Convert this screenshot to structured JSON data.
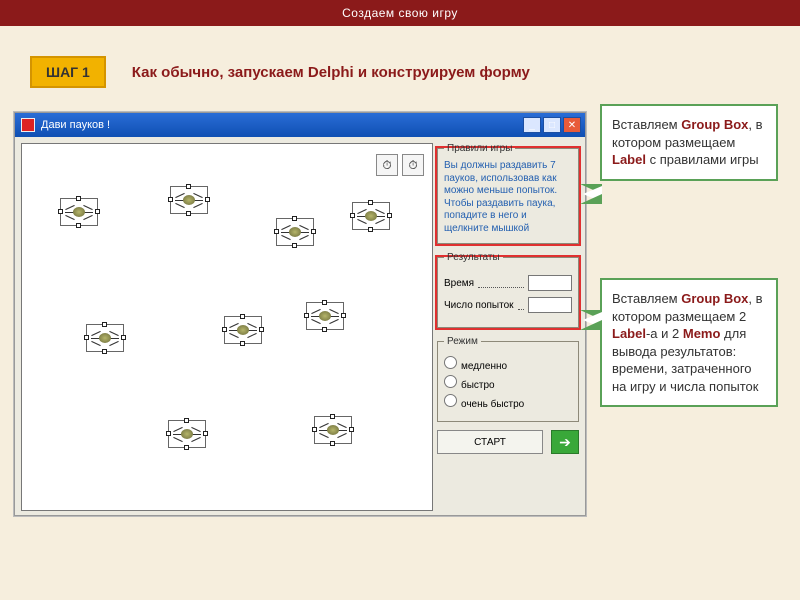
{
  "header": "Создаем свою игру",
  "step": {
    "badge": "ШАГ 1",
    "title": "Как обычно, запускаем Delphi и конструируем форму"
  },
  "window": {
    "title": "Дави пауков !",
    "rules": {
      "legend": "Правили игры",
      "text": "Вы должны раздавить 7 пауков, использовав как можно меньше попыток. Чтобы раздавить паука, попадите в него и щелкните мышкой"
    },
    "results": {
      "legend": "Результаты",
      "time_label": "Время",
      "attempts_label": "Число попыток"
    },
    "mode": {
      "legend": "Режим",
      "options": [
        "медленно",
        "быстро",
        "очень быстро"
      ]
    },
    "start_button": "СТАРТ",
    "go_button": "➔"
  },
  "callouts": {
    "top": {
      "prefix": "Вставляем ",
      "kw1": "Group Box",
      "mid": ", в котором размещаем ",
      "kw2": "Label",
      "suffix": " с правилами игры"
    },
    "bottom": {
      "prefix": "Вставляем ",
      "kw1": "Group Box",
      "mid1": ", в котором размещаем 2 ",
      "kw2": "Label",
      "mid2": "-а и 2 ",
      "kw3": "Memo",
      "suffix": " для вывода результатов: времени, затраченного на игру и числа попыток"
    }
  }
}
